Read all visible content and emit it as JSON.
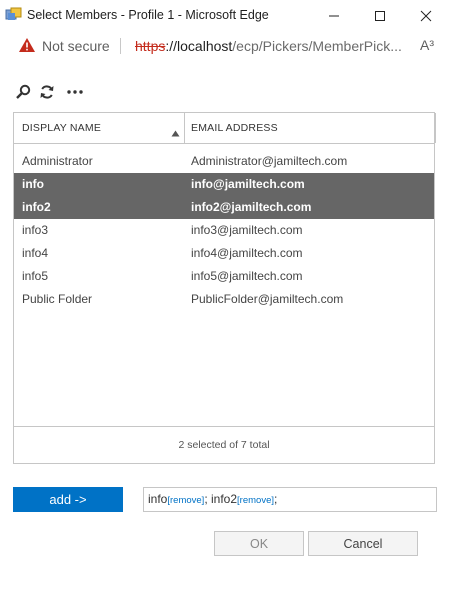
{
  "window": {
    "title": "Select Members - Profile 1 - Microsoft Edge"
  },
  "address_bar": {
    "security_label": "Not secure",
    "url_scheme": "https",
    "url_host": "://localhost",
    "url_path": "/ecp/Pickers/MemberPick...",
    "read_aloud": "A³"
  },
  "toolbar": {
    "more_label": "•••"
  },
  "grid": {
    "columns": [
      "DISPLAY NAME",
      "EMAIL ADDRESS"
    ],
    "rows": [
      {
        "name": "Administrator",
        "email": "Administrator@jamiltech.com",
        "selected": false
      },
      {
        "name": "info",
        "email": "info@jamiltech.com",
        "selected": true
      },
      {
        "name": "info2",
        "email": "info2@jamiltech.com",
        "selected": true
      },
      {
        "name": "info3",
        "email": "info3@jamiltech.com",
        "selected": false
      },
      {
        "name": "info4",
        "email": "info4@jamiltech.com",
        "selected": false
      },
      {
        "name": "info5",
        "email": "info5@jamiltech.com",
        "selected": false
      },
      {
        "name": "Public Folder",
        "email": "PublicFolder@jamiltech.com",
        "selected": false
      }
    ],
    "footer": "2 selected of 7 total"
  },
  "picker": {
    "add_label": "add ->",
    "selected": [
      {
        "name": "info",
        "remove": "[remove]",
        "sep": "; "
      },
      {
        "name": "info2",
        "remove": "[remove]",
        "sep": ";"
      }
    ]
  },
  "buttons": {
    "ok": "OK",
    "cancel": "Cancel"
  },
  "colors": {
    "accent": "#0072c6",
    "selected_row": "#666666",
    "warning": "#c42b1c"
  }
}
